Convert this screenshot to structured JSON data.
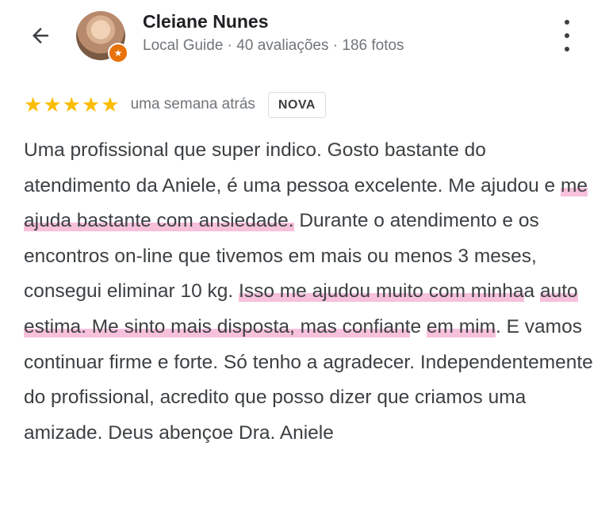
{
  "header": {
    "back_icon": "arrow-back-icon",
    "reviewer": {
      "name": "Cleiane Nunes",
      "level": "Local Guide",
      "reviews": "40 avaliações",
      "photos": "186 fotos",
      "separator": " · "
    },
    "menu_icon": "more-vert-icon"
  },
  "review": {
    "rating": 5,
    "stars": [
      "★",
      "★",
      "★",
      "★",
      "★"
    ],
    "time": "uma semana atrás",
    "badge": "NOVA",
    "segments": [
      {
        "text": "Uma profissional que super indico. Gosto bastante do atendimento da Aniele, é uma pessoa excelente. Me ajudou e ",
        "highlight": false
      },
      {
        "text": "me ajuda bastante com ansiedade.",
        "highlight": true
      },
      {
        "text": " Durante o atendimento e os encontros on-line que tivemos em mais ou menos 3 meses, consegui eliminar 10 kg. ",
        "highlight": false
      },
      {
        "text": "Isso me ajudou muito com minha",
        "highlight": true
      },
      {
        "text": "a ",
        "highlight": false
      },
      {
        "text": "auto estima. Me sinto mais disposta, mas confiant",
        "highlight": true
      },
      {
        "text": "e ",
        "highlight": false
      },
      {
        "text": "em mim",
        "highlight": true
      },
      {
        "text": ". E vamos continuar firme e forte. Só tenho a agradecer. Independentemente do profissional, acredito que posso dizer que criamos uma amizade. Deus abençoe Dra. Aniele",
        "highlight": false
      }
    ]
  },
  "colors": {
    "star": "#fbbc04",
    "highlight": "#f08cbe",
    "guide_badge": "#e8710a"
  }
}
